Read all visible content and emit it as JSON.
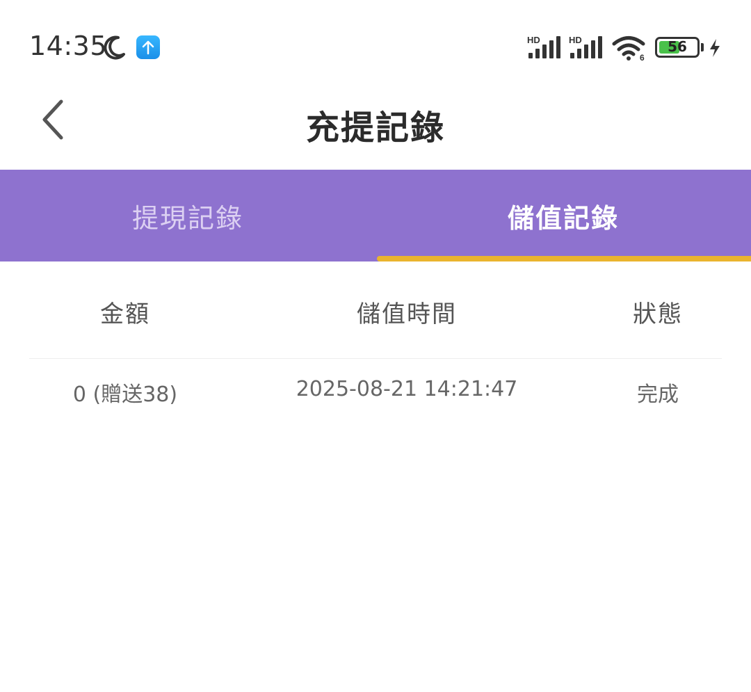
{
  "status_bar": {
    "time": "14:35",
    "icons": [
      "moon-icon",
      "upload-icon",
      "signal-hd-icon",
      "signal-hd-icon",
      "wifi-icon",
      "battery-icon",
      "charging-bolt-icon"
    ],
    "signal1_label": "HD",
    "signal2_label": "HD",
    "wifi_label": "6",
    "battery_level": "56",
    "battery_fraction": 0.56,
    "battery_color": "#49c14a"
  },
  "header": {
    "title": "充提記錄",
    "back_icon": "chevron-left-icon"
  },
  "tabs": {
    "items": [
      {
        "label": "提現記錄"
      },
      {
        "label": "儲值記錄"
      }
    ],
    "active_index": 1,
    "bar_color": "#8e72cf",
    "indicator_color": "#eab42e"
  },
  "table": {
    "columns": [
      "金額",
      "儲值時間",
      "狀態"
    ],
    "rows": [
      {
        "amount": "0 (贈送38)",
        "time": "2025-08-21 14:21:47",
        "status": "完成"
      }
    ]
  }
}
